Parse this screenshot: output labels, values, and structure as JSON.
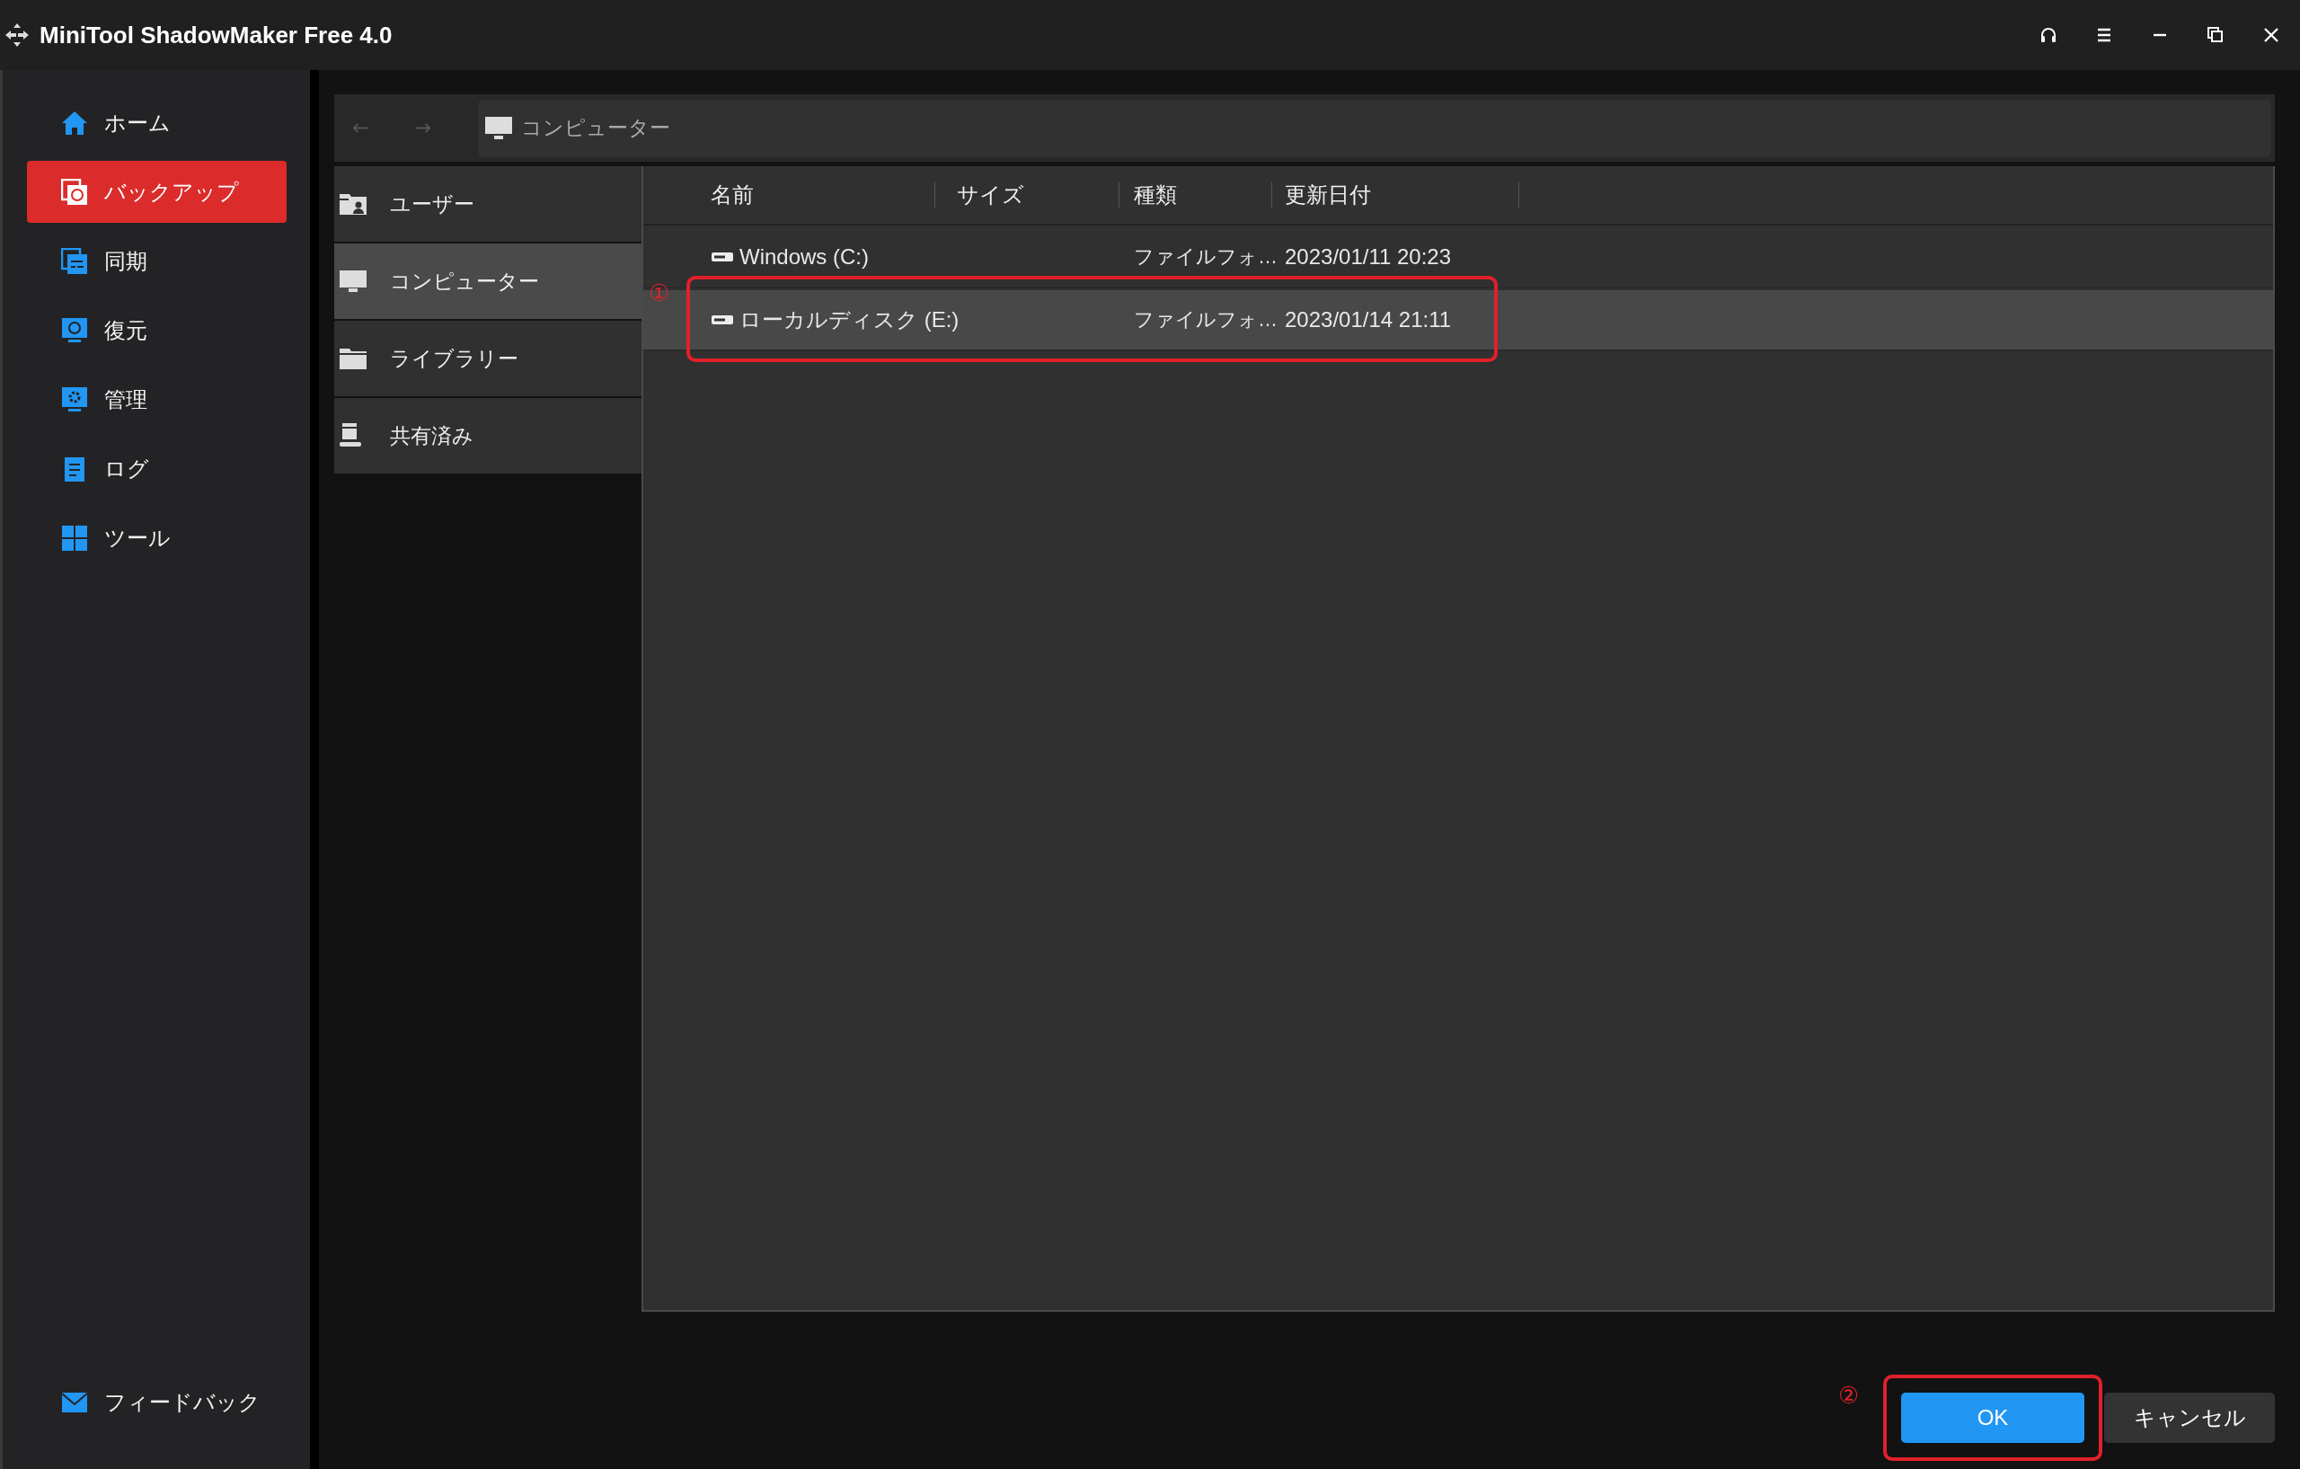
{
  "window": {
    "title": "MiniTool ShadowMaker Free 4.0"
  },
  "sidebar": {
    "items": [
      {
        "label": "ホーム",
        "selected": false
      },
      {
        "label": "バックアップ",
        "selected": true
      },
      {
        "label": "同期",
        "selected": false
      },
      {
        "label": "復元",
        "selected": false
      },
      {
        "label": "管理",
        "selected": false
      },
      {
        "label": "ログ",
        "selected": false
      },
      {
        "label": "ツール",
        "selected": false
      }
    ],
    "footer": {
      "label": "フィードバック"
    }
  },
  "dialog": {
    "address": {
      "label": "コンピューター"
    },
    "places": [
      {
        "label": "ユーザー",
        "selected": false
      },
      {
        "label": "コンピューター",
        "selected": true
      },
      {
        "label": "ライブラリー",
        "selected": false
      },
      {
        "label": "共有済み",
        "selected": false
      }
    ],
    "table": {
      "columns": [
        "名前",
        "サイズ",
        "種類",
        "更新日付"
      ],
      "rows": [
        {
          "name": "Windows (C:)",
          "type": "ファイルフォ…",
          "modified": "2023/01/11 20:23",
          "selected": false
        },
        {
          "name": "ローカルディスク (E:)",
          "type": "ファイルフォ…",
          "modified": "2023/01/14 21:11",
          "selected": true,
          "annotation": "①"
        }
      ]
    },
    "buttons": [
      {
        "label": "OK",
        "kind": "primary",
        "annotation": "②"
      },
      {
        "label": "キャンセル",
        "kind": "secondary"
      }
    ]
  }
}
